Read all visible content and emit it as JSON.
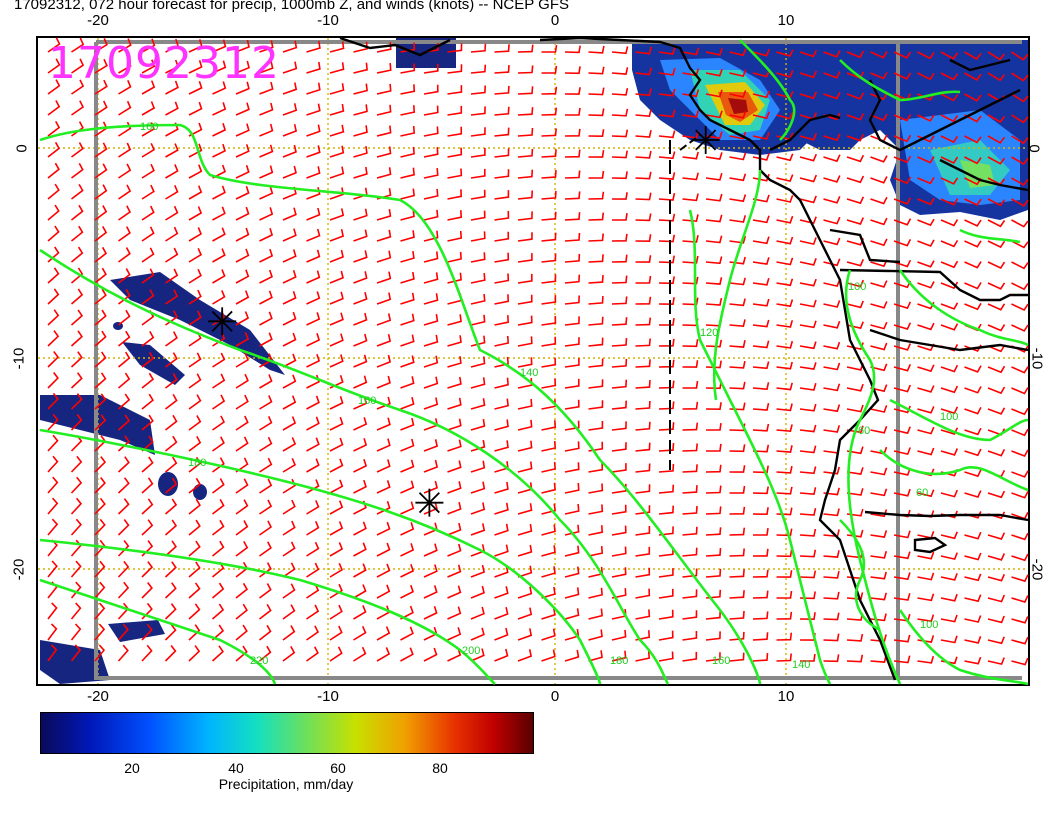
{
  "title": "17092312, 072 hour forecast for precip, 1000mb Z, and winds (knots) -- NCEP GFS",
  "timestamp": "17092312",
  "map": {
    "lon_min": -22.5,
    "lon_max": 20.5,
    "lat_min": -23.5,
    "lat_max": 5.0,
    "lon_ticks": [
      "-20",
      "-10",
      "0",
      "10"
    ],
    "lat_ticks": [
      "0",
      "-10",
      "-20"
    ],
    "contour_color": "#22ee22",
    "wind_barb_color": "#ff0000",
    "coastline_color": "#000000",
    "grid_color": "#d6b400",
    "contour_labels": [
      "160",
      "140",
      "160",
      "180",
      "200",
      "220",
      "180",
      "160",
      "140",
      "120",
      "100",
      "100",
      "60",
      "60",
      "100"
    ],
    "high_markers": [
      {
        "lon": -14.5,
        "lat": -7.5
      },
      {
        "lon": -5.5,
        "lat": -15.5
      },
      {
        "lon": 6.5,
        "lat": 0.5
      }
    ]
  },
  "colorbar": {
    "ticks": [
      "20",
      "40",
      "60",
      "80"
    ],
    "label": "Precipitation, mm/day",
    "colors": [
      "#0a0a5a",
      "#0018b8",
      "#0050ff",
      "#00b4ff",
      "#14e0c0",
      "#6ee05a",
      "#c8e000",
      "#f0a000",
      "#e83200",
      "#c00000",
      "#5a0000"
    ]
  }
}
